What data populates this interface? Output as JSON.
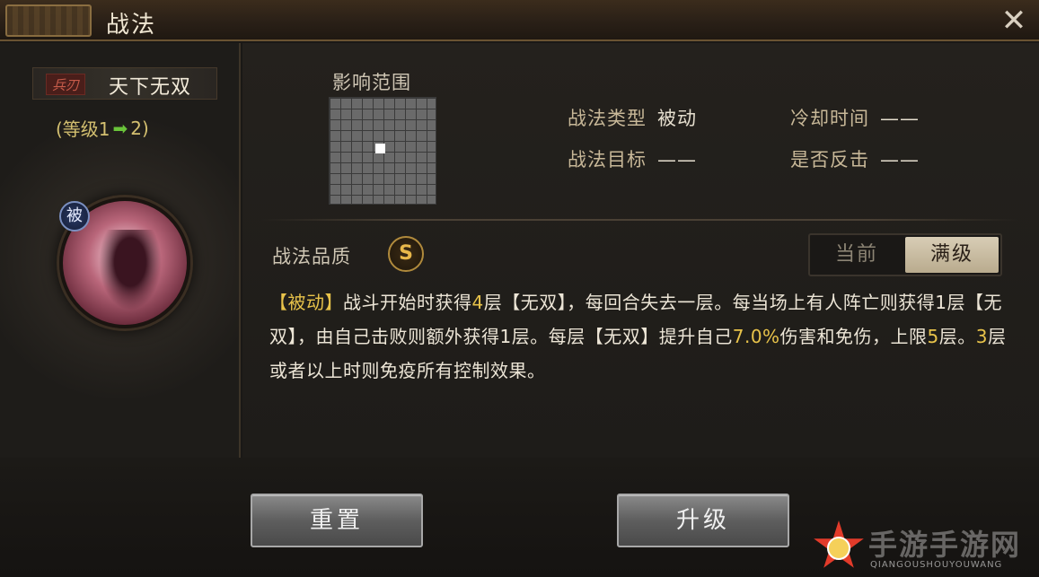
{
  "title": "战法",
  "skill": {
    "type_tag": "兵刃",
    "name": "天下无双",
    "level_prefix": "(等级1",
    "level_suffix": "2)",
    "badge": "被"
  },
  "range": {
    "label": "影响范围"
  },
  "info": {
    "type_key": "战法类型",
    "type_val": "被动",
    "target_key": "战法目标",
    "target_val": "——",
    "cooldown_key": "冷却时间",
    "cooldown_val": "——",
    "counter_key": "是否反击",
    "counter_val": "——"
  },
  "quality": {
    "label": "战法品质",
    "grade": "S"
  },
  "toggle": {
    "current": "当前",
    "max": "满级",
    "selected": "满级"
  },
  "description": {
    "tag": "【被动】",
    "p1": "战斗开始时获得",
    "n1": "4",
    "p2": "层【无双】，每回合失去一层。每当场上有人阵亡则获得1层【无双】，由自己击败则额外获得1层。每层【无双】提升自己",
    "n2": "7.0%",
    "p3": "伤害和免伤，上限",
    "n3": "5",
    "p4": "层。",
    "n4": "3",
    "p5": "层或者以上时则免疫所有控制效果。"
  },
  "buttons": {
    "reset": "重置",
    "upgrade": "升级"
  },
  "watermark": {
    "text": "手游手游网",
    "sub": "QIANGOUSHOUYOUWANG"
  },
  "colors": {
    "highlight": "#e8c34a",
    "level_arrow": "#6ac43a",
    "tag_red": "#c75b4a"
  }
}
